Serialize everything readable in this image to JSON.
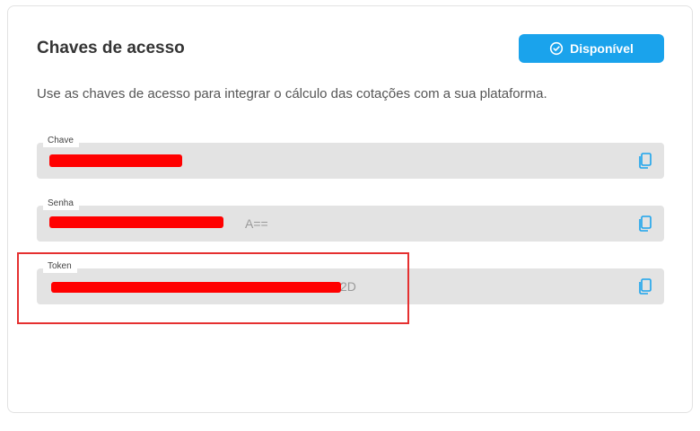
{
  "card": {
    "title": "Chaves de acesso",
    "status_label": "Disponível",
    "description": "Use as chaves de acesso para integrar o cálculo das cotações com a sua plataforma."
  },
  "fields": [
    {
      "label": "Chave",
      "value": ""
    },
    {
      "label": "Senha",
      "value": "A=="
    },
    {
      "label": "Token",
      "value": "2D"
    }
  ],
  "colors": {
    "accent": "#1aa3ec",
    "field_bg": "#e3e3e3",
    "redaction": "#ff0000",
    "highlight": "#e53030"
  },
  "icons": {
    "status": "check-circle-icon",
    "copy": "copy-icon"
  }
}
